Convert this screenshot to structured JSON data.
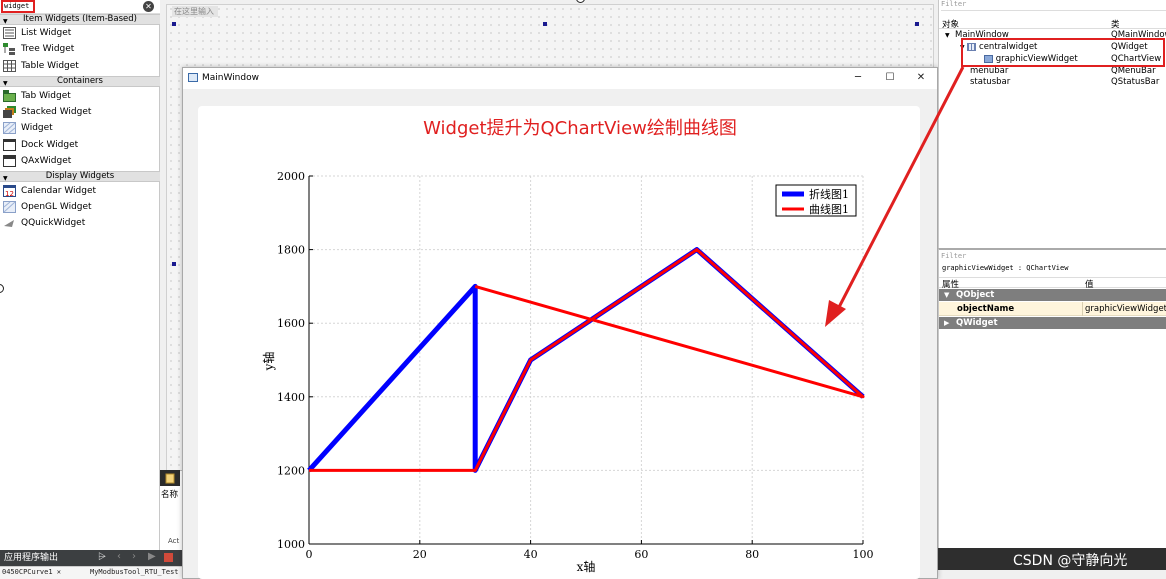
{
  "widget_box": {
    "filter_value": "widget",
    "categories": [
      {
        "label": "Item Widgets (Item-Based)",
        "items": [
          "List Widget",
          "Tree Widget",
          "Table Widget"
        ]
      },
      {
        "label": "Containers",
        "items": [
          "Tab Widget",
          "Stacked Widget",
          "Widget",
          "Dock Widget",
          "QAxWidget"
        ]
      },
      {
        "label": "Display Widgets",
        "items": [
          "Calendar Widget",
          "OpenGL Widget",
          "QQuickWidget"
        ]
      }
    ]
  },
  "form": {
    "menubar_hint": "在这里输入"
  },
  "dock": {
    "name_label": "名称",
    "act_label": "Act"
  },
  "output": {
    "title": "应用程序输出",
    "tabs": [
      "0450CPCurve1",
      "MyModbusTool_RTU_Test"
    ]
  },
  "main_window": {
    "title": "MainWindow",
    "annotation": "Widget提升为QChartView绘制曲线图"
  },
  "chart_data": {
    "type": "line",
    "xlabel": "x轴",
    "ylabel": "y轴",
    "xlim": [
      0,
      100
    ],
    "ylim": [
      1000,
      2000
    ],
    "xticks": [
      0,
      20,
      40,
      60,
      80,
      100
    ],
    "yticks": [
      1000,
      1200,
      1400,
      1600,
      1800,
      2000
    ],
    "grid": true,
    "legend_position": "top-right",
    "series": [
      {
        "name": "折线图1",
        "color": "#0000ff",
        "style": "polyline",
        "points": [
          [
            0,
            1200
          ],
          [
            30,
            1700
          ],
          [
            30,
            1200
          ],
          [
            40,
            1500
          ],
          [
            70,
            1800
          ],
          [
            100,
            1400
          ]
        ]
      },
      {
        "name": "曲线图1",
        "color": "#ff0000",
        "style": "spline",
        "points": [
          [
            0,
            1200
          ],
          [
            30,
            1200
          ],
          [
            40,
            1500
          ],
          [
            70,
            1800
          ],
          [
            100,
            1400
          ],
          [
            30,
            1700
          ]
        ]
      }
    ]
  },
  "object_inspector": {
    "filter_label": "Filter",
    "columns": [
      "对象",
      "类"
    ],
    "rows": [
      {
        "name": "MainWindow",
        "cls": "QMainWindow"
      },
      {
        "name": "centralwidget",
        "cls": "QWidget"
      },
      {
        "name": "graphicViewWidget",
        "cls": "QChartView"
      },
      {
        "name": "menubar",
        "cls": "QMenuBar"
      },
      {
        "name": "statusbar",
        "cls": "QStatusBar"
      }
    ]
  },
  "property_editor": {
    "filter_label": "Filter",
    "object_label": "graphicViewWidget : QChartView",
    "columns": [
      "属性",
      "值"
    ],
    "group_qobject": "QObject",
    "object_name_key": "objectName",
    "object_name_value": "graphicViewWidget",
    "group_qwidget": "QWidget"
  },
  "watermark": "CSDN @守静向光"
}
